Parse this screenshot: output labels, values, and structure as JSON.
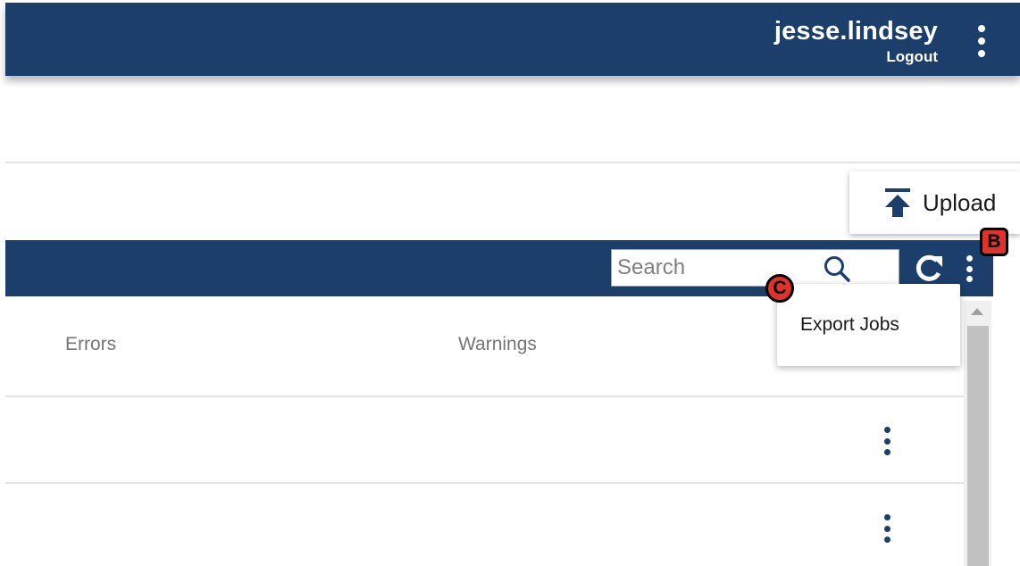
{
  "header": {
    "username": "jesse.lindsey",
    "logout_label": "Logout",
    "menu_icon": "kebab-menu-icon"
  },
  "toolbar": {
    "upload_label": "Upload",
    "upload_icon": "upload-arrow-icon"
  },
  "table": {
    "search_placeholder": "Search",
    "search_icon": "search-icon",
    "refresh_icon": "refresh-icon",
    "menu_icon": "kebab-menu-icon",
    "columns": [
      "Errors",
      "Warnings"
    ],
    "row_menu_icon": "kebab-menu-icon",
    "row_count": 2
  },
  "dropdown": {
    "items": [
      "Export Jobs"
    ]
  },
  "annotations": {
    "marker_b": "B",
    "marker_c": "C"
  },
  "colors": {
    "primary_navy": "#1b3e6b",
    "marker_red": "#e0312c",
    "header_text": "#757575",
    "divider": "#e4e4e4"
  }
}
